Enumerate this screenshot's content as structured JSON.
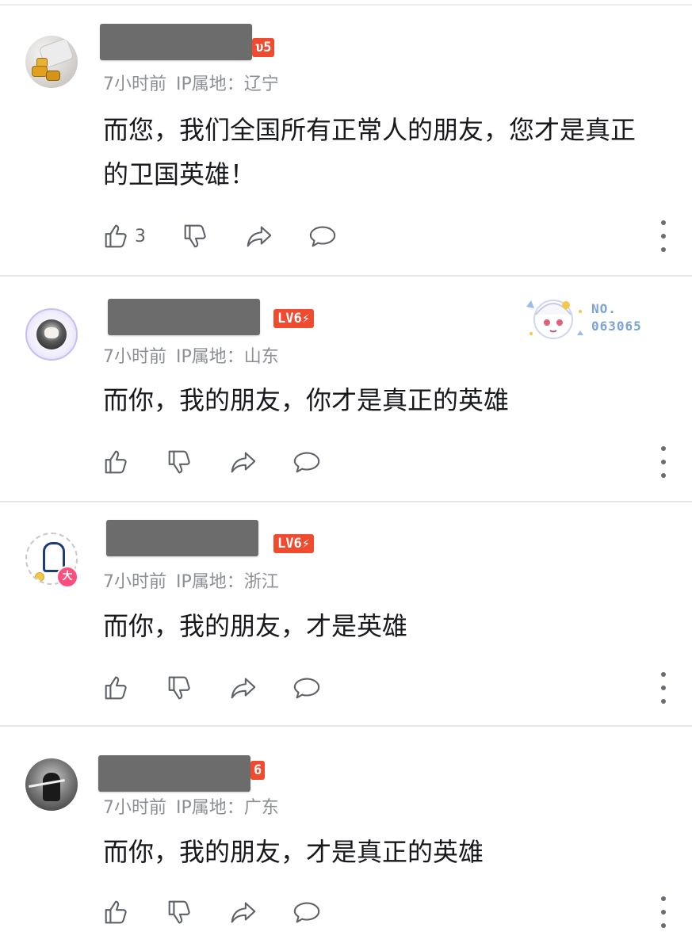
{
  "comments": [
    {
      "level_badge": "LV5",
      "level_badge_visible": "υ5",
      "time": "7小时前",
      "ip_label": "IP属地：",
      "ip": "辽宁",
      "text_line1": "而您，我们全国所有正常人的朋友，您才是真正",
      "text_line2": "的卫国英雄！",
      "likes": "3"
    },
    {
      "level_badge": "LV6⚡",
      "time": "7小时前",
      "ip_label": "IP属地：",
      "ip": "山东",
      "text_line1": "而你，我的朋友，你才是真正的英雄",
      "fan_card": {
        "label": "NO.",
        "number": "063065"
      }
    },
    {
      "level_badge": "LV6⚡",
      "avatar_badge": "大",
      "time": "7小时前",
      "ip_label": "IP属地：",
      "ip": "浙江",
      "text_line1": "而你，我的朋友，才是英雄"
    },
    {
      "level_badge_visible": "6",
      "time": "7小时前",
      "ip_label": "IP属地：",
      "ip": "广东",
      "text_line1": "而你，我的朋友，才是真正的英雄"
    }
  ],
  "icons": {
    "like": "thumb-up-icon",
    "dislike": "thumb-down-icon",
    "share": "share-icon",
    "reply": "reply-bubble-icon",
    "more": "more-dots-icon"
  },
  "colors": {
    "level_badge": "#f04a2f",
    "meta_text": "#8c8f96",
    "fan_number": "#7aa4d6"
  }
}
